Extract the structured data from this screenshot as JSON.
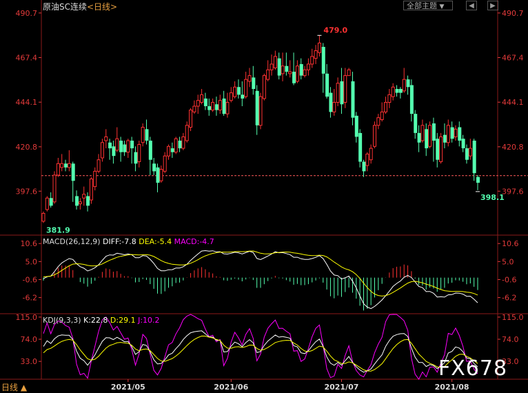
{
  "header": {
    "instrument": "原油SC连续",
    "period_label": "<日线>",
    "theme_button": "全部主题",
    "theme_arrow": "▼",
    "prev_button": "◀",
    "next_button": "▶"
  },
  "period_tab": "日线 ▲",
  "watermark": "FX678",
  "colors": {
    "up": "#ff3232",
    "down": "#54ffb0",
    "axis": "#e23a3a",
    "grid": "#8b1a1a",
    "diff": "#ffffff",
    "dea": "#ffff00",
    "kdj_j": "#ff00ff",
    "ref_line": "#ff5a5a"
  },
  "macd_header": {
    "name": "MACD(26,12,9)",
    "diff": "DIFF:-7.8",
    "dea": "DEA:-5.4",
    "macd": "MACD:-4.7"
  },
  "kdj_header": {
    "name": "KDJ(9,3,3)",
    "k": "K:22.8",
    "d": "D:29.1",
    "j": "J:10.2"
  },
  "chart_data": [
    {
      "type": "candlestick",
      "title": "原油SC连续",
      "y_ticks": [
        "490.7",
        "467.4",
        "444.1",
        "420.8",
        "397.6"
      ],
      "ylim": [
        375,
        491
      ],
      "x_ticks": [
        "2021/05",
        "2021/06",
        "2021/07",
        "2021/08"
      ],
      "annotations": {
        "max": "479.0",
        "min": "381.9",
        "last_low": "398.1"
      },
      "reference_price": 405.7,
      "candles": [
        [
          381.9,
          386,
          381,
          387
        ],
        [
          388,
          394,
          387,
          395
        ],
        [
          394,
          390,
          389,
          397
        ],
        [
          392,
          406,
          391,
          408
        ],
        [
          406,
          412,
          405,
          415
        ],
        [
          410,
          412,
          408,
          417
        ],
        [
          412,
          410,
          408,
          414
        ],
        [
          410,
          412,
          408,
          419
        ],
        [
          412,
          403,
          392,
          413
        ],
        [
          395,
          390,
          388,
          398
        ],
        [
          391,
          392,
          388,
          394
        ],
        [
          394,
          396,
          390,
          400
        ],
        [
          395,
          390,
          387,
          397
        ],
        [
          393,
          404,
          391,
          405
        ],
        [
          400,
          408,
          398,
          410
        ],
        [
          408,
          414,
          407,
          417
        ],
        [
          415,
          423,
          413,
          425
        ],
        [
          424,
          426,
          420,
          430
        ],
        [
          423,
          420,
          414,
          425
        ],
        [
          421,
          416,
          412,
          424
        ],
        [
          419,
          425,
          418,
          431
        ],
        [
          424,
          418,
          413,
          426
        ],
        [
          422,
          418,
          416,
          424
        ],
        [
          418,
          424,
          415,
          425
        ],
        [
          424,
          420,
          412,
          426
        ],
        [
          418,
          412,
          408,
          421
        ],
        [
          413,
          422,
          410,
          424
        ],
        [
          423,
          431,
          421,
          433
        ],
        [
          430,
          424,
          422,
          435
        ],
        [
          424,
          414,
          406,
          426
        ],
        [
          412,
          408,
          406,
          415
        ],
        [
          410,
          402,
          397,
          412
        ],
        [
          403,
          409,
          402,
          411
        ],
        [
          408,
          416,
          407,
          418
        ],
        [
          416,
          421,
          414,
          422
        ],
        [
          420,
          418,
          415,
          423
        ],
        [
          418,
          425,
          417,
          426
        ],
        [
          424,
          420,
          418,
          426
        ],
        [
          420,
          426,
          419,
          428
        ],
        [
          424,
          432,
          423,
          434
        ],
        [
          431,
          440,
          429,
          441
        ],
        [
          439,
          442,
          438,
          445
        ],
        [
          442,
          445,
          438,
          448
        ],
        [
          444,
          448,
          443,
          451
        ],
        [
          446,
          442,
          440,
          449
        ],
        [
          442,
          440,
          437,
          446
        ],
        [
          440,
          444,
          439,
          446
        ],
        [
          443,
          440,
          437,
          447
        ],
        [
          440,
          445,
          438,
          448
        ],
        [
          446,
          438,
          437,
          450
        ],
        [
          438,
          444,
          436,
          449
        ],
        [
          445,
          449,
          444,
          452
        ],
        [
          447,
          452,
          446,
          455
        ],
        [
          452,
          448,
          446,
          456
        ],
        [
          448,
          446,
          442,
          455
        ],
        [
          447,
          456,
          446,
          460
        ],
        [
          455,
          458,
          452,
          462
        ],
        [
          457,
          451,
          448,
          463
        ],
        [
          450,
          432,
          427,
          453
        ],
        [
          432,
          447,
          430,
          449
        ],
        [
          446,
          458,
          445,
          459
        ],
        [
          456,
          461,
          455,
          466
        ],
        [
          461,
          464,
          458,
          469
        ],
        [
          462,
          468,
          461,
          471
        ],
        [
          467,
          458,
          456,
          470
        ],
        [
          459,
          463,
          455,
          470
        ],
        [
          463,
          460,
          458,
          470
        ],
        [
          459,
          460,
          457,
          466
        ],
        [
          460,
          454,
          453,
          470
        ],
        [
          455,
          463,
          454,
          466
        ],
        [
          464,
          458,
          456,
          467
        ],
        [
          458,
          461,
          457,
          463
        ],
        [
          461,
          464,
          458,
          467
        ],
        [
          464,
          468,
          462,
          472
        ],
        [
          467,
          471,
          464,
          474
        ],
        [
          470,
          475,
          468,
          479
        ],
        [
          473,
          459,
          449,
          475
        ],
        [
          459,
          447,
          446,
          464
        ],
        [
          449,
          439,
          436,
          452
        ],
        [
          439,
          444,
          437,
          451
        ],
        [
          444,
          454,
          442,
          457
        ],
        [
          455,
          443,
          438,
          462
        ],
        [
          444,
          458,
          441,
          462
        ],
        [
          458,
          461,
          459,
          462
        ],
        [
          455,
          436,
          432,
          460
        ],
        [
          437,
          426,
          423,
          439
        ],
        [
          428,
          413,
          410,
          430
        ],
        [
          413,
          408,
          405,
          414
        ],
        [
          411,
          417,
          408,
          418
        ],
        [
          414,
          420,
          412,
          422
        ],
        [
          421,
          432,
          420,
          434
        ],
        [
          432,
          436,
          430,
          438
        ],
        [
          435,
          439,
          434,
          444
        ],
        [
          439,
          444,
          438,
          447
        ],
        [
          444,
          448,
          441,
          451
        ],
        [
          447,
          452,
          445,
          454
        ],
        [
          451,
          449,
          447,
          453
        ],
        [
          451,
          449,
          446,
          452
        ],
        [
          450,
          456,
          449,
          462
        ],
        [
          456,
          452,
          448,
          458
        ],
        [
          453,
          438,
          434,
          456
        ],
        [
          438,
          428,
          425,
          440
        ],
        [
          428,
          423,
          418,
          432
        ],
        [
          424,
          432,
          423,
          435
        ],
        [
          430,
          420,
          416,
          433
        ],
        [
          421,
          432,
          420,
          434
        ],
        [
          433,
          424,
          413,
          436
        ],
        [
          425,
          414,
          410,
          428
        ],
        [
          413,
          426,
          412,
          428
        ],
        [
          427,
          423,
          420,
          433
        ],
        [
          423,
          432,
          421,
          435
        ],
        [
          431,
          425,
          423,
          434
        ],
        [
          426,
          430,
          424,
          432
        ],
        [
          431,
          424,
          421,
          434
        ],
        [
          425,
          420,
          418,
          427
        ],
        [
          420,
          414,
          412,
          422
        ],
        [
          416,
          420,
          414,
          425
        ],
        [
          424,
          407,
          403,
          425
        ],
        [
          405,
          402,
          398.1,
          406
        ]
      ]
    },
    {
      "type": "bar",
      "title": "MACD(26,12,9)",
      "y_ticks": [
        "10.6",
        "5.0",
        "-0.6",
        "-6.2"
      ],
      "ylim": [
        -11,
        13
      ],
      "series": [
        {
          "name": "DIFF",
          "values": []
        },
        {
          "name": "DEA",
          "values": []
        },
        {
          "name": "MACD",
          "values": []
        }
      ],
      "diff_last": -7.8,
      "dea_last": -5.4,
      "macd_last": -4.7
    },
    {
      "type": "line",
      "title": "KDJ(9,3,3)",
      "y_ticks": [
        "115.0",
        "74.0",
        "33.0"
      ],
      "ylim": [
        0,
        120
      ],
      "k_last": 22.8,
      "d_last": 29.1,
      "j_last": 10.2
    }
  ]
}
